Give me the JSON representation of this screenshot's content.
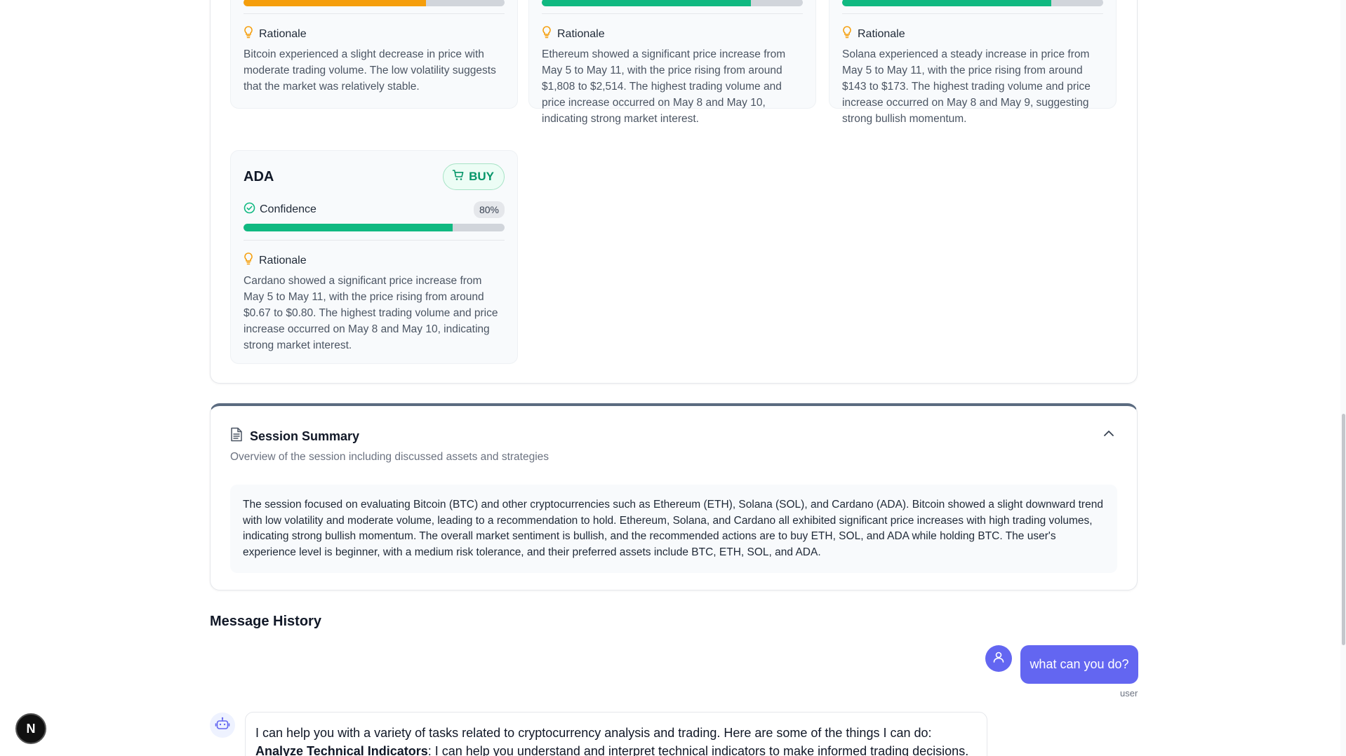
{
  "cards_top": [
    {
      "rationale_label": "Rationale",
      "bar_color": "#f59e0b",
      "confidence_fraction": 0.7,
      "rationale": "Bitcoin experienced a slight decrease in price with moderate trading volume. The low volatility suggests that the market was relatively stable."
    },
    {
      "rationale_label": "Rationale",
      "bar_color": "#10b981",
      "confidence_fraction": 0.8,
      "rationale": "Ethereum showed a significant price increase from May 5 to May 11, with the price rising from around $1,808 to $2,514. The highest trading volume and price increase occurred on May 8 and May 10, indicating strong market interest."
    },
    {
      "rationale_label": "Rationale",
      "bar_color": "#10b981",
      "confidence_fraction": 0.8,
      "rationale": "Solana experienced a steady increase in price from May 5 to May 11, with the price rising from around $143 to $173. The highest trading volume and price increase occurred on May 8 and May 9, suggesting strong bullish momentum."
    }
  ],
  "ada_card": {
    "asset": "ADA",
    "action": "BUY",
    "confidence_label": "Confidence",
    "confidence_value": "80%",
    "confidence_fraction": 0.8,
    "bar_color": "#10b981",
    "rationale_label": "Rationale",
    "rationale": "Cardano showed a significant price increase from May 5 to May 11, with the price rising from around $0.67 to $0.80. The highest trading volume and price increase occurred on May 8 and May 10, indicating strong market interest."
  },
  "summary": {
    "title": "Session Summary",
    "subtitle": "Overview of the session including discussed assets and strategies",
    "body": "The session focused on evaluating Bitcoin (BTC) and other cryptocurrencies such as Ethereum (ETH), Solana (SOL), and Cardano (ADA). Bitcoin showed a slight downward trend with low volatility and moderate volume, leading to a recommendation to hold. Ethereum, Solana, and Cardano all exhibited significant price increases with high trading volumes, indicating strong bullish momentum. The overall market sentiment is bullish, and the recommended actions are to buy ETH, SOL, and ADA while holding BTC. The user's experience level is beginner, with a medium risk tolerance, and their preferred assets include BTC, ETH, SOL, and ADA."
  },
  "history": {
    "title": "Message History",
    "user_message": "what can you do?",
    "user_label": "user",
    "bot_intro": "I can help you with a variety of tasks related to cryptocurrency analysis and trading. Here are some of the things I can do:",
    "bot_item_title": "Analyze Technical Indicators",
    "bot_item_text": ": I can help you understand and interpret technical indicators to make informed trading decisions."
  },
  "next_badge": "N",
  "colors": {
    "accent": "#6366f1",
    "buy_green": "#059669",
    "hold_orange": "#f59e0b"
  }
}
